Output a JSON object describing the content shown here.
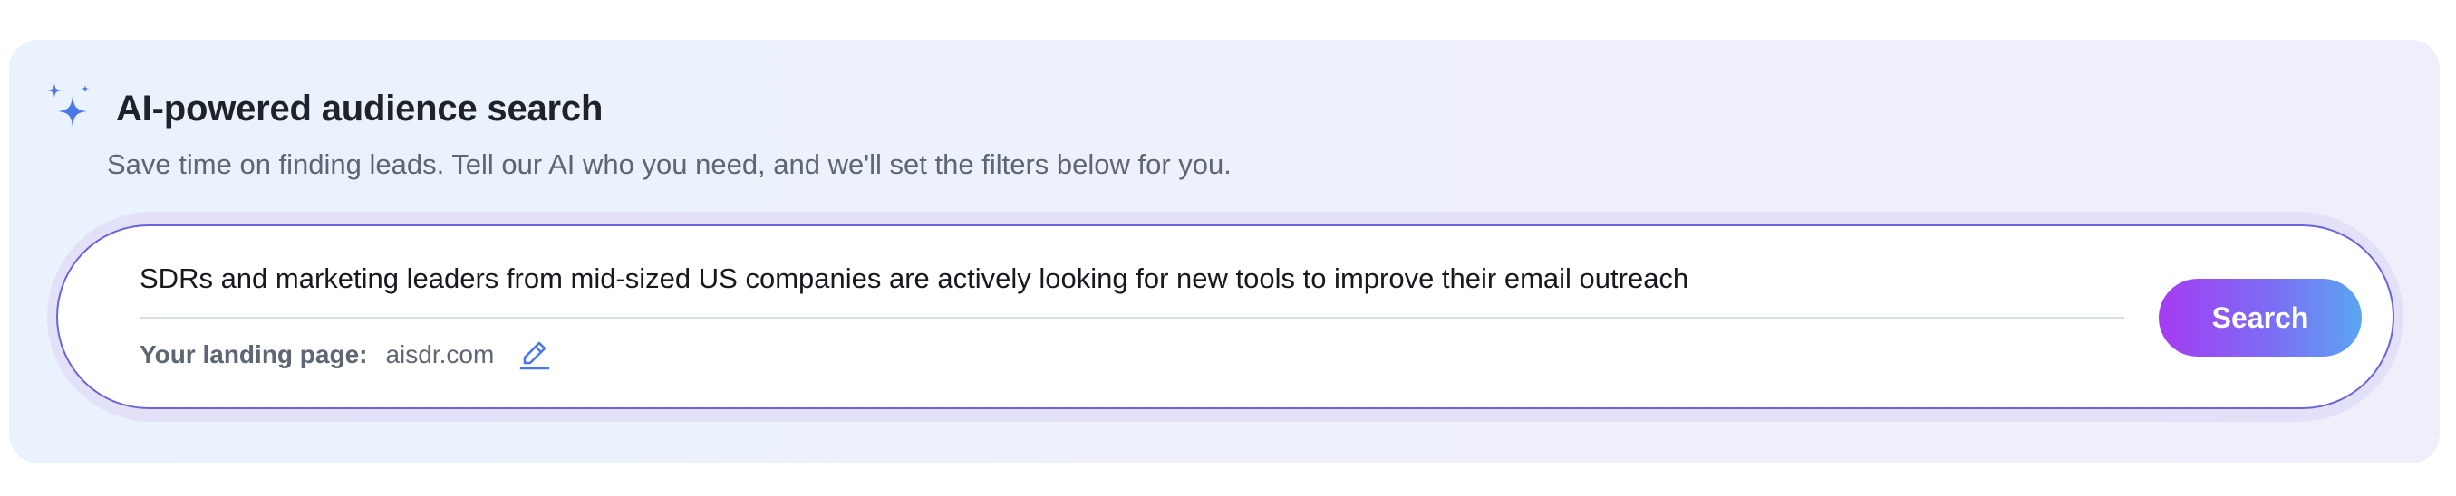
{
  "header": {
    "icon": "sparkle-icon",
    "title": "AI-powered audience search",
    "subtitle": "Save time on finding leads. Tell our AI who you need, and we'll set the filters below for you."
  },
  "search": {
    "query_value": "SDRs and marketing leaders from mid-sized US companies are actively looking for new tools to improve their email outreach",
    "landing_label": "Your landing page:",
    "landing_value": "aisdr.com",
    "edit_icon": "pencil-icon",
    "button_label": "Search"
  },
  "colors": {
    "accent_blue": "#4b78e8",
    "button_gradient_start": "#a53cf0",
    "button_gradient_end": "#5aa6f0",
    "input_border": "#6a63dc"
  }
}
